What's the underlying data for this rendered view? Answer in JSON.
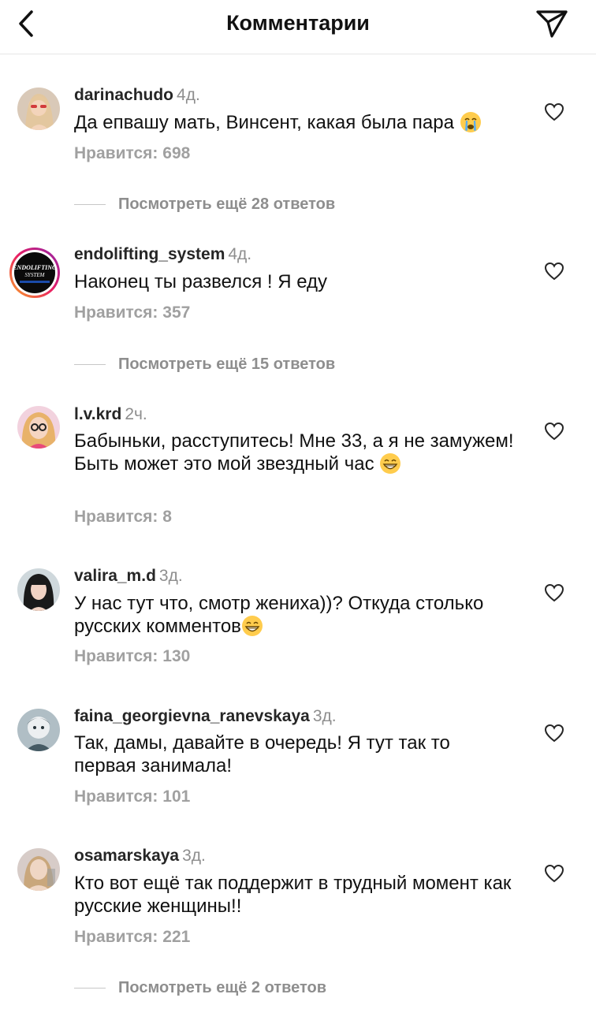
{
  "header": {
    "title": "Комментарии",
    "back_icon": "chevron-left-icon",
    "send_icon": "paper-plane-icon"
  },
  "comments": [
    {
      "username": "darinachudo",
      "time": "4д.",
      "text": "Да епвашу мать, Винсент, какая была пара",
      "likes": "Нравится: 698",
      "replies": "Посмотреть ещё 28 ответов",
      "emoji": "crying-face"
    },
    {
      "username": "endolifting_system",
      "time": "4д.",
      "text": "Наконец ты развелся ! Я еду",
      "likes": "Нравится: 357",
      "replies": "Посмотреть ещё 15 ответов",
      "avatar_text": "ENDOLIFTING SYSTEM"
    },
    {
      "username": "l.v.krd",
      "time": "2ч.",
      "text": "Бабыньки, расступитесь! Мне 33, а я не замужем! Быть может это мой звездный час",
      "likes": "Нравится: 8",
      "emoji": "grinning-face"
    },
    {
      "username": "valira_m.d",
      "time": "3д.",
      "text": "У нас тут что, смотр жениха))? Откуда столько русских комментов",
      "likes": "Нравится: 130",
      "emoji": "grinning-face"
    },
    {
      "username": "faina_georgievna_ranevskaya",
      "time": "3д.",
      "text": "Так, дамы, давайте в очередь! Я тут так то первая занимала!",
      "likes": "Нравится: 101"
    },
    {
      "username": "osamarskaya",
      "time": "3д.",
      "text": "Кто вот ещё так поддержит в трудный момент как русские женщины!!",
      "likes": "Нравится: 221",
      "replies": "Посмотреть ещё 2 ответов"
    }
  ],
  "colors": {
    "accent": "#262626",
    "muted": "#8e8e8e",
    "likes": "#a0a0a0",
    "divider": "#e6e6e6"
  }
}
